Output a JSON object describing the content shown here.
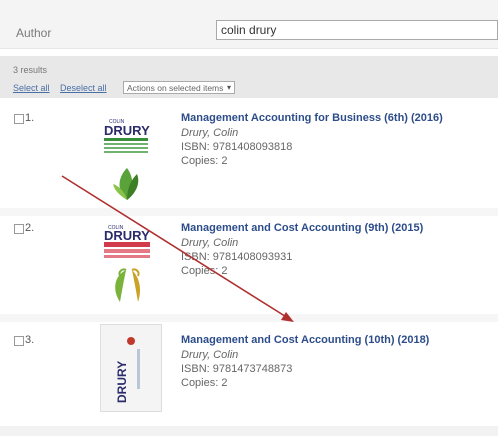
{
  "search": {
    "author_label": "Author",
    "author_value": "colin drury"
  },
  "results": {
    "count_text": "3 results",
    "select_all": "Select all",
    "deselect_all": "Deselect all",
    "actions_label": "Actions on selected items"
  },
  "items": [
    {
      "number": "1.",
      "title": "Management Accounting for Business (6th) (2016)",
      "author": "Drury, Colin",
      "isbn": "ISBN: 9781408093818",
      "copies": "Copies: 2",
      "cover": {
        "top_text": "COLIN",
        "name": "DRURY",
        "accent": "#3a8f3a"
      }
    },
    {
      "number": "2.",
      "title": "Management and Cost Accounting (9th) (2015)",
      "author": "Drury, Colin",
      "isbn": "ISBN: 9781408093931",
      "copies": "Copies: 2",
      "cover": {
        "top_text": "COLIN",
        "name": "DRURY",
        "accent": "#d23b4c"
      }
    },
    {
      "number": "3.",
      "title": "Management and Cost Accounting (10th) (2018)",
      "author": "Drury, Colin",
      "isbn": "ISBN: 9781473748873",
      "copies": "Copies: 2",
      "cover": {
        "name": "DRURY",
        "accent": "#c0392b"
      }
    }
  ],
  "annotation": {
    "color": "#b03030"
  },
  "colors": {
    "link": "#2d4d8a",
    "text": "#666666"
  }
}
